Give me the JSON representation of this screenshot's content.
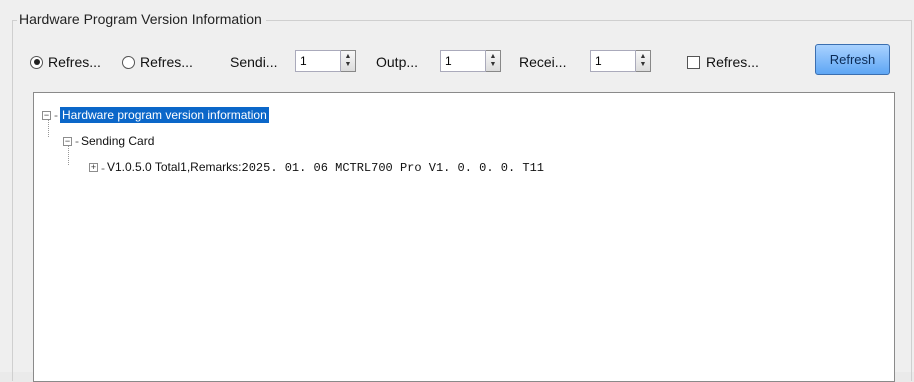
{
  "group": {
    "title": "Hardware Program Version Information"
  },
  "toolbar": {
    "radio1": "Refres...",
    "radio2": "Refres...",
    "sending_label": "Sendi...",
    "sending_value": "1",
    "output_label": "Outp...",
    "output_value": "1",
    "receiving_label": "Recei...",
    "receiving_value": "1",
    "checkbox_label": "Refres...",
    "refresh_button": "Refresh"
  },
  "tree": {
    "root": "Hardware program version information",
    "child": "Sending Card",
    "leaf_prefix": "V1.0.5.0 Total1,Remarks:",
    "leaf_suffix": "2025. 01. 06 MCTRL700 Pro V1. 0. 0. 0. T11"
  }
}
